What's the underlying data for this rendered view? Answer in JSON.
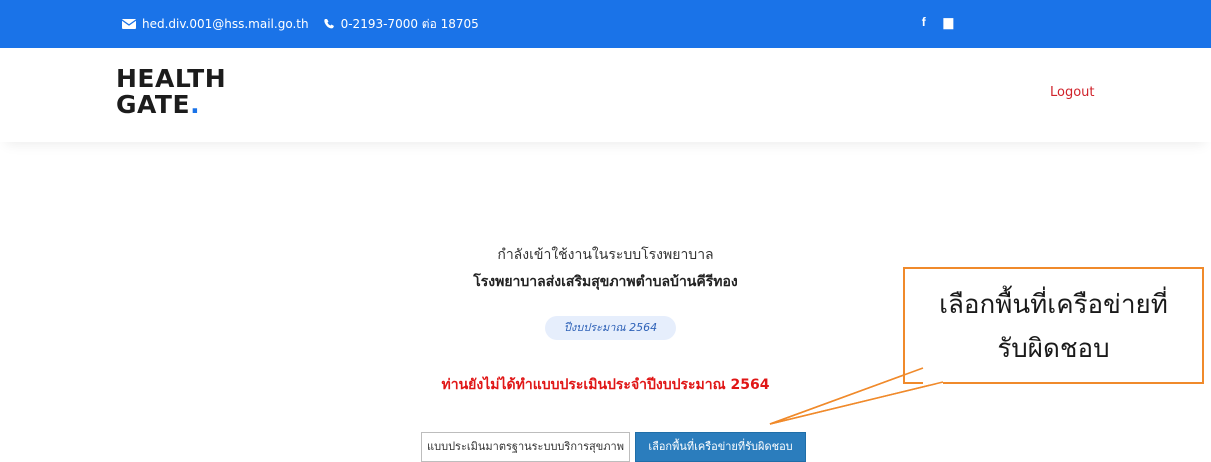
{
  "topbar": {
    "email": "hed.div.001@hss.mail.go.th",
    "phone": "0-2193-7000 ต่อ 18705",
    "social": [
      "f",
      "▆"
    ],
    "color": "#1a73e8"
  },
  "header": {
    "logo_line1": "HEALTH",
    "logo_line2": "GATE",
    "logo_dot": ".",
    "logout": "Logout"
  },
  "main": {
    "intro": "กำลังเข้าใช้งานในระบบโรงพยาบาล",
    "hospital": "โรงพยาบาลส่งเสริมสุขภาพตำบลบ้านคีรีทอง",
    "fiscal_badge": "ปีงบประมาณ 2564",
    "warning": "ท่านยังไม่ได้ทำแบบประเมินประจำปีงบประมาณ 2564",
    "assess_button": "แบบประเมินมาตรฐานระบบบริการสุขภาพ",
    "select_button": "เลือกพื้นที่เครือข่ายที่รับผิดชอบ"
  },
  "callout": {
    "line1": "เลือกพื้นที่เครือข่ายที่",
    "line2": "รับผิดชอบ",
    "border_color": "#f08a2b"
  }
}
